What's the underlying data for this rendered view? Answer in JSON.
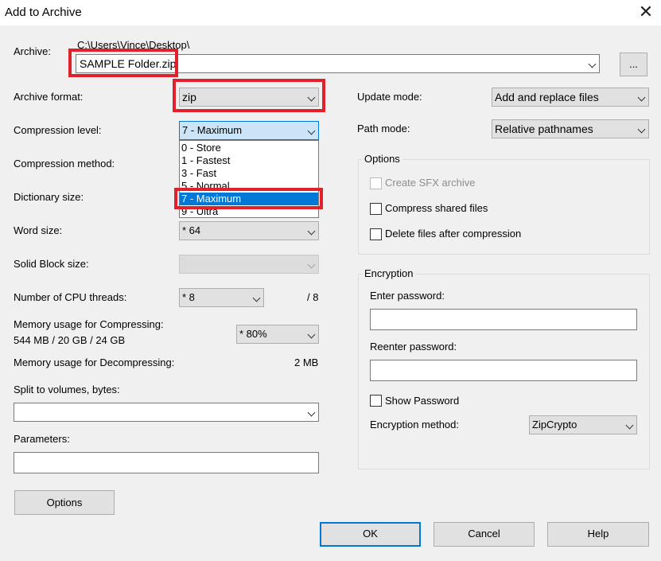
{
  "window": {
    "title": "Add to Archive",
    "close_symbol": "✕"
  },
  "archive": {
    "label": "Archive:",
    "path": "C:\\Users\\Vince\\Desktop\\",
    "filename": "SAMPLE Folder.zip",
    "browse_label": "..."
  },
  "left": {
    "archive_format": {
      "label": "Archive format:",
      "value": "zip"
    },
    "compression_level": {
      "label": "Compression level:",
      "value": "7 - Maximum",
      "options": [
        "0 - Store",
        "1 - Fastest",
        "3 - Fast",
        "5 - Normal",
        "7 - Maximum",
        "9 - Ultra"
      ],
      "selected_index": 4
    },
    "compression_method": {
      "label": "Compression method:"
    },
    "dictionary_size": {
      "label": "Dictionary size:"
    },
    "word_size": {
      "label": "Word size:",
      "value": "* 64"
    },
    "solid_block_size": {
      "label": "Solid Block size:",
      "value": ""
    },
    "cpu_threads": {
      "label": "Number of CPU threads:",
      "value": "* 8",
      "max": "/ 8"
    },
    "memory_compress": {
      "label": "Memory usage for Compressing:",
      "detail": "544 MB / 20 GB / 24 GB",
      "value": "* 80%"
    },
    "memory_decompress": {
      "label": "Memory usage for Decompressing:",
      "value": "2 MB"
    },
    "split_volumes": {
      "label": "Split to volumes, bytes:",
      "value": ""
    },
    "parameters": {
      "label": "Parameters:",
      "value": ""
    },
    "options_button": "Options"
  },
  "right": {
    "update_mode": {
      "label": "Update mode:",
      "value": "Add and replace files"
    },
    "path_mode": {
      "label": "Path mode:",
      "value": "Relative pathnames"
    },
    "options_group": {
      "title": "Options",
      "create_sfx": {
        "label": "Create SFX archive",
        "checked": false,
        "enabled": false
      },
      "compress_shared": {
        "label": "Compress shared files",
        "checked": false
      },
      "delete_after": {
        "label": "Delete files after compression",
        "checked": false
      }
    },
    "encryption_group": {
      "title": "Encryption",
      "enter_password_label": "Enter password:",
      "reenter_password_label": "Reenter password:",
      "show_password": {
        "label": "Show Password",
        "checked": false
      },
      "method_label": "Encryption method:",
      "method_value": "ZipCrypto"
    }
  },
  "buttons": {
    "ok": "OK",
    "cancel": "Cancel",
    "help": "Help"
  },
  "colors": {
    "highlight": "#e0212c",
    "selection": "#0078d7",
    "dialog_bg": "#f0f0f0"
  }
}
